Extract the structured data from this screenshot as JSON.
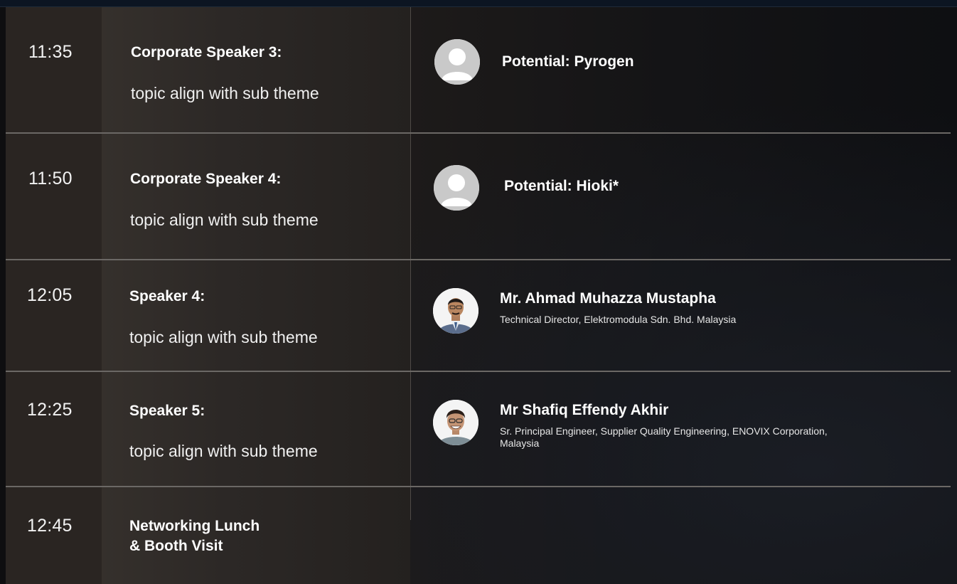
{
  "schedule": [
    {
      "time": "11:35",
      "title": "Corporate Speaker 3:",
      "topic": "topic align with sub theme",
      "speaker_name": "Potential: Pyrogen",
      "speaker_role": "",
      "avatar": "placeholder-person-icon"
    },
    {
      "time": "11:50",
      "title": "Corporate Speaker 4:",
      "topic": "topic align with sub theme",
      "speaker_name": "Potential: Hioki*",
      "speaker_role": "",
      "avatar": "placeholder-person-icon"
    },
    {
      "time": "12:05",
      "title": "Speaker 4:",
      "topic": "topic align with sub theme",
      "speaker_name": "Mr. Ahmad Muhazza Mustapha",
      "speaker_role": "Technical Director, Elektromodula Sdn. Bhd. Malaysia",
      "avatar": "speaker-photo"
    },
    {
      "time": "12:25",
      "title": "Speaker 5:",
      "topic": "topic align with sub theme",
      "speaker_name": "Mr Shafiq Effendy Akhir",
      "speaker_role": "Sr. Principal Engineer, Supplier Quality Engineering, ENOVIX Corporation, Malaysia",
      "avatar": "speaker-photo"
    },
    {
      "time": "12:45",
      "title_line1": "Networking Lunch",
      "title_line2": "& Booth Visit"
    }
  ],
  "colors": {
    "background": "#141416",
    "time_column": "#2a2522",
    "topic_column": "#302b28",
    "divider": "#6b6865",
    "text": "#ffffff"
  }
}
